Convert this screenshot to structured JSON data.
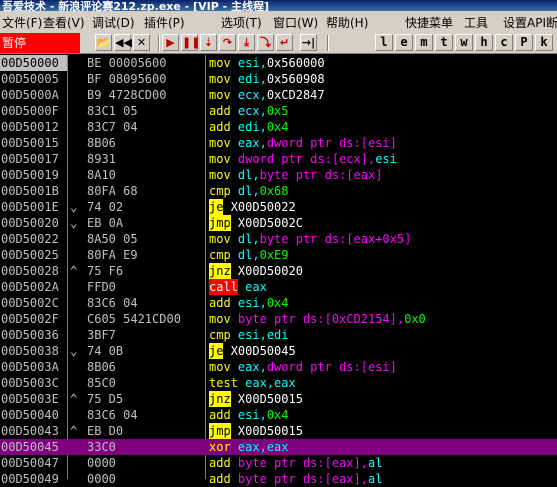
{
  "window": {
    "title": "吾爱技术 - 新浪评论赛212.zp.exe - [VIP - 主线程]"
  },
  "menu": [
    {
      "label": "文件(F)"
    },
    {
      "label": "查看(V)"
    },
    {
      "label": "调试(D)"
    },
    {
      "label": "插件(P)"
    },
    {
      "label": "选项(T)"
    },
    {
      "label": "窗口(W)"
    },
    {
      "label": "帮助(H)"
    },
    {
      "label": "快捷菜单"
    },
    {
      "label": "工具"
    },
    {
      "label": "设置API断"
    }
  ],
  "toolbar": {
    "status": "暂停",
    "buttons": [
      {
        "name": "open-icon",
        "glyph": "📂",
        "style": "black"
      },
      {
        "name": "rewind-icon",
        "glyph": "◀◀",
        "style": "black"
      },
      {
        "name": "close-icon",
        "glyph": "✕",
        "style": "black"
      },
      {
        "name": "run-icon",
        "glyph": "▶",
        "style": "red"
      },
      {
        "name": "pause-icon",
        "glyph": "❚❚",
        "style": "red"
      },
      {
        "name": "step-into-icon",
        "glyph": "⇣",
        "style": "red"
      },
      {
        "name": "step-over-icon",
        "glyph": "↷",
        "style": "red"
      },
      {
        "name": "trace-into-icon",
        "glyph": "⤓",
        "style": "red"
      },
      {
        "name": "trace-over-icon",
        "glyph": "⤵",
        "style": "red"
      },
      {
        "name": "execute-till-return-icon",
        "glyph": "↵",
        "style": "red"
      },
      {
        "name": "goto-icon",
        "glyph": "→|",
        "style": "black"
      }
    ],
    "letters": [
      "l",
      "e",
      "m",
      "t",
      "w",
      "h",
      "c",
      "P",
      "k"
    ]
  },
  "disasm": [
    {
      "addr": "00D50000",
      "mark": "",
      "hex": "BE 00005600",
      "mnem": "mov",
      "ops": [
        {
          "t": "esi,",
          "c": "#00ffff"
        },
        {
          "t": "0x560000",
          "c": "#ffffff"
        }
      ]
    },
    {
      "addr": "00D50005",
      "mark": "",
      "hex": "BF 08095600",
      "mnem": "mov",
      "ops": [
        {
          "t": "edi,",
          "c": "#00ffff"
        },
        {
          "t": "0x560908",
          "c": "#ffffff"
        }
      ]
    },
    {
      "addr": "00D5000A",
      "mark": "",
      "hex": "B9 4728CD00",
      "mnem": "mov",
      "ops": [
        {
          "t": "ecx,",
          "c": "#00ffff"
        },
        {
          "t": "0xCD2847",
          "c": "#ffffff"
        }
      ]
    },
    {
      "addr": "00D5000F",
      "mark": "",
      "hex": "83C1 05",
      "mnem": "add",
      "ops": [
        {
          "t": "ecx,",
          "c": "#00ffff"
        },
        {
          "t": "0x5",
          "c": "#00ff00"
        }
      ]
    },
    {
      "addr": "00D50012",
      "mark": "",
      "hex": "83C7 04",
      "mnem": "add",
      "ops": [
        {
          "t": "edi,",
          "c": "#00ffff"
        },
        {
          "t": "0x4",
          "c": "#00ff00"
        }
      ]
    },
    {
      "addr": "00D50015",
      "mark": "",
      "hex": "8B06",
      "mnem": "mov",
      "ops": [
        {
          "t": "eax,",
          "c": "#00ffff"
        },
        {
          "t": "dword ptr ds:[esi]",
          "c": "#ff00ff"
        }
      ]
    },
    {
      "addr": "00D50017",
      "mark": "",
      "hex": "8931",
      "mnem": "mov",
      "ops": [
        {
          "t": "dword ptr ds:[ecx],",
          "c": "#ff00ff"
        },
        {
          "t": "esi",
          "c": "#00ffff"
        }
      ]
    },
    {
      "addr": "00D50019",
      "mark": "",
      "hex": "8A10",
      "mnem": "mov",
      "ops": [
        {
          "t": "dl,",
          "c": "#00ffff"
        },
        {
          "t": "byte ptr ds:[eax]",
          "c": "#ff00ff"
        }
      ]
    },
    {
      "addr": "00D5001B",
      "mark": "",
      "hex": "80FA 68",
      "mnem": "cmp",
      "ops": [
        {
          "t": "dl,",
          "c": "#00ffff"
        },
        {
          "t": "0x68",
          "c": "#00ff00"
        }
      ]
    },
    {
      "addr": "00D5001E",
      "mark": "⌄",
      "hex": "74 02",
      "mnem": "je",
      "mnemStyle": "yellow",
      "ops": [
        {
          "t": "X00D50022",
          "c": "#ffffff"
        }
      ]
    },
    {
      "addr": "00D50020",
      "mark": "⌄",
      "hex": "EB 0A",
      "mnem": "jmp",
      "mnemStyle": "yellow",
      "ops": [
        {
          "t": "X00D5002C",
          "c": "#ffffff"
        }
      ]
    },
    {
      "addr": "00D50022",
      "mark": "",
      "hex": "8A50 05",
      "mnem": "mov",
      "ops": [
        {
          "t": "dl,",
          "c": "#00ffff"
        },
        {
          "t": "byte ptr ds:[eax+0x5]",
          "c": "#ff00ff"
        }
      ]
    },
    {
      "addr": "00D50025",
      "mark": "",
      "hex": "80FA E9",
      "mnem": "cmp",
      "ops": [
        {
          "t": "dl,",
          "c": "#00ffff"
        },
        {
          "t": "0xE9",
          "c": "#00ff00"
        }
      ]
    },
    {
      "addr": "00D50028",
      "mark": "^",
      "hex": "75 F6",
      "mnem": "jnz",
      "mnemStyle": "yellow",
      "ops": [
        {
          "t": "X00D50020",
          "c": "#ffffff"
        }
      ]
    },
    {
      "addr": "00D5002A",
      "mark": "",
      "hex": "FFD0",
      "mnem": "call",
      "mnemStyle": "red",
      "ops": [
        {
          "t": "eax",
          "c": "#00ffff"
        }
      ]
    },
    {
      "addr": "00D5002C",
      "mark": "",
      "hex": "83C6 04",
      "mnem": "add",
      "ops": [
        {
          "t": "esi,",
          "c": "#00ffff"
        },
        {
          "t": "0x4",
          "c": "#00ff00"
        }
      ]
    },
    {
      "addr": "00D5002F",
      "mark": "",
      "hex": "C605 5421CD00",
      "mnem": "mov",
      "ops": [
        {
          "t": "byte ptr ds:[0xCD2154],",
          "c": "#ff00ff"
        },
        {
          "t": "0x0",
          "c": "#00ff00"
        }
      ]
    },
    {
      "addr": "00D50036",
      "mark": "",
      "hex": "3BF7",
      "mnem": "cmp",
      "ops": [
        {
          "t": "esi,edi",
          "c": "#00ffff"
        }
      ]
    },
    {
      "addr": "00D50038",
      "mark": "⌄",
      "hex": "74 0B",
      "mnem": "je",
      "mnemStyle": "yellow",
      "ops": [
        {
          "t": "X00D50045",
          "c": "#ffffff"
        }
      ]
    },
    {
      "addr": "00D5003A",
      "mark": "",
      "hex": "8B06",
      "mnem": "mov",
      "ops": [
        {
          "t": "eax,",
          "c": "#00ffff"
        },
        {
          "t": "dword ptr ds:[esi]",
          "c": "#ff00ff"
        }
      ]
    },
    {
      "addr": "00D5003C",
      "mark": "",
      "hex": "85C0",
      "mnem": "test",
      "ops": [
        {
          "t": "eax,eax",
          "c": "#00ffff"
        }
      ]
    },
    {
      "addr": "00D5003E",
      "mark": "^",
      "hex": "75 D5",
      "mnem": "jnz",
      "mnemStyle": "yellow",
      "ops": [
        {
          "t": "X00D50015",
          "c": "#ffffff"
        }
      ]
    },
    {
      "addr": "00D50040",
      "mark": "",
      "hex": "83C6 04",
      "mnem": "add",
      "ops": [
        {
          "t": "esi,",
          "c": "#00ffff"
        },
        {
          "t": "0x4",
          "c": "#00ff00"
        }
      ]
    },
    {
      "addr": "00D50043",
      "mark": "^",
      "hex": "EB D0",
      "mnem": "jmp",
      "mnemStyle": "yellow",
      "ops": [
        {
          "t": "X00D50015",
          "c": "#ffffff"
        }
      ]
    },
    {
      "addr": "00D50045",
      "mark": "",
      "hex": "33C0",
      "mnem": "xor",
      "selected": true,
      "ops": [
        {
          "t": "eax,eax",
          "c": "#00ffff"
        }
      ]
    },
    {
      "addr": "00D50047",
      "mark": "",
      "hex": "0000",
      "mnem": "add",
      "ops": [
        {
          "t": "byte ptr ds:[eax],",
          "c": "#ff00ff"
        },
        {
          "t": "al",
          "c": "#00ffff"
        }
      ]
    },
    {
      "addr": "00D50049",
      "mark": "",
      "hex": "0000",
      "mnem": "add",
      "ops": [
        {
          "t": "byte ptr ds:[eax],",
          "c": "#ff00ff"
        },
        {
          "t": "al",
          "c": "#00ffff"
        }
      ]
    }
  ],
  "colors": {
    "mnemonic": "#ffff00",
    "address_current": "#c0c0c0",
    "selection": "#800080"
  }
}
